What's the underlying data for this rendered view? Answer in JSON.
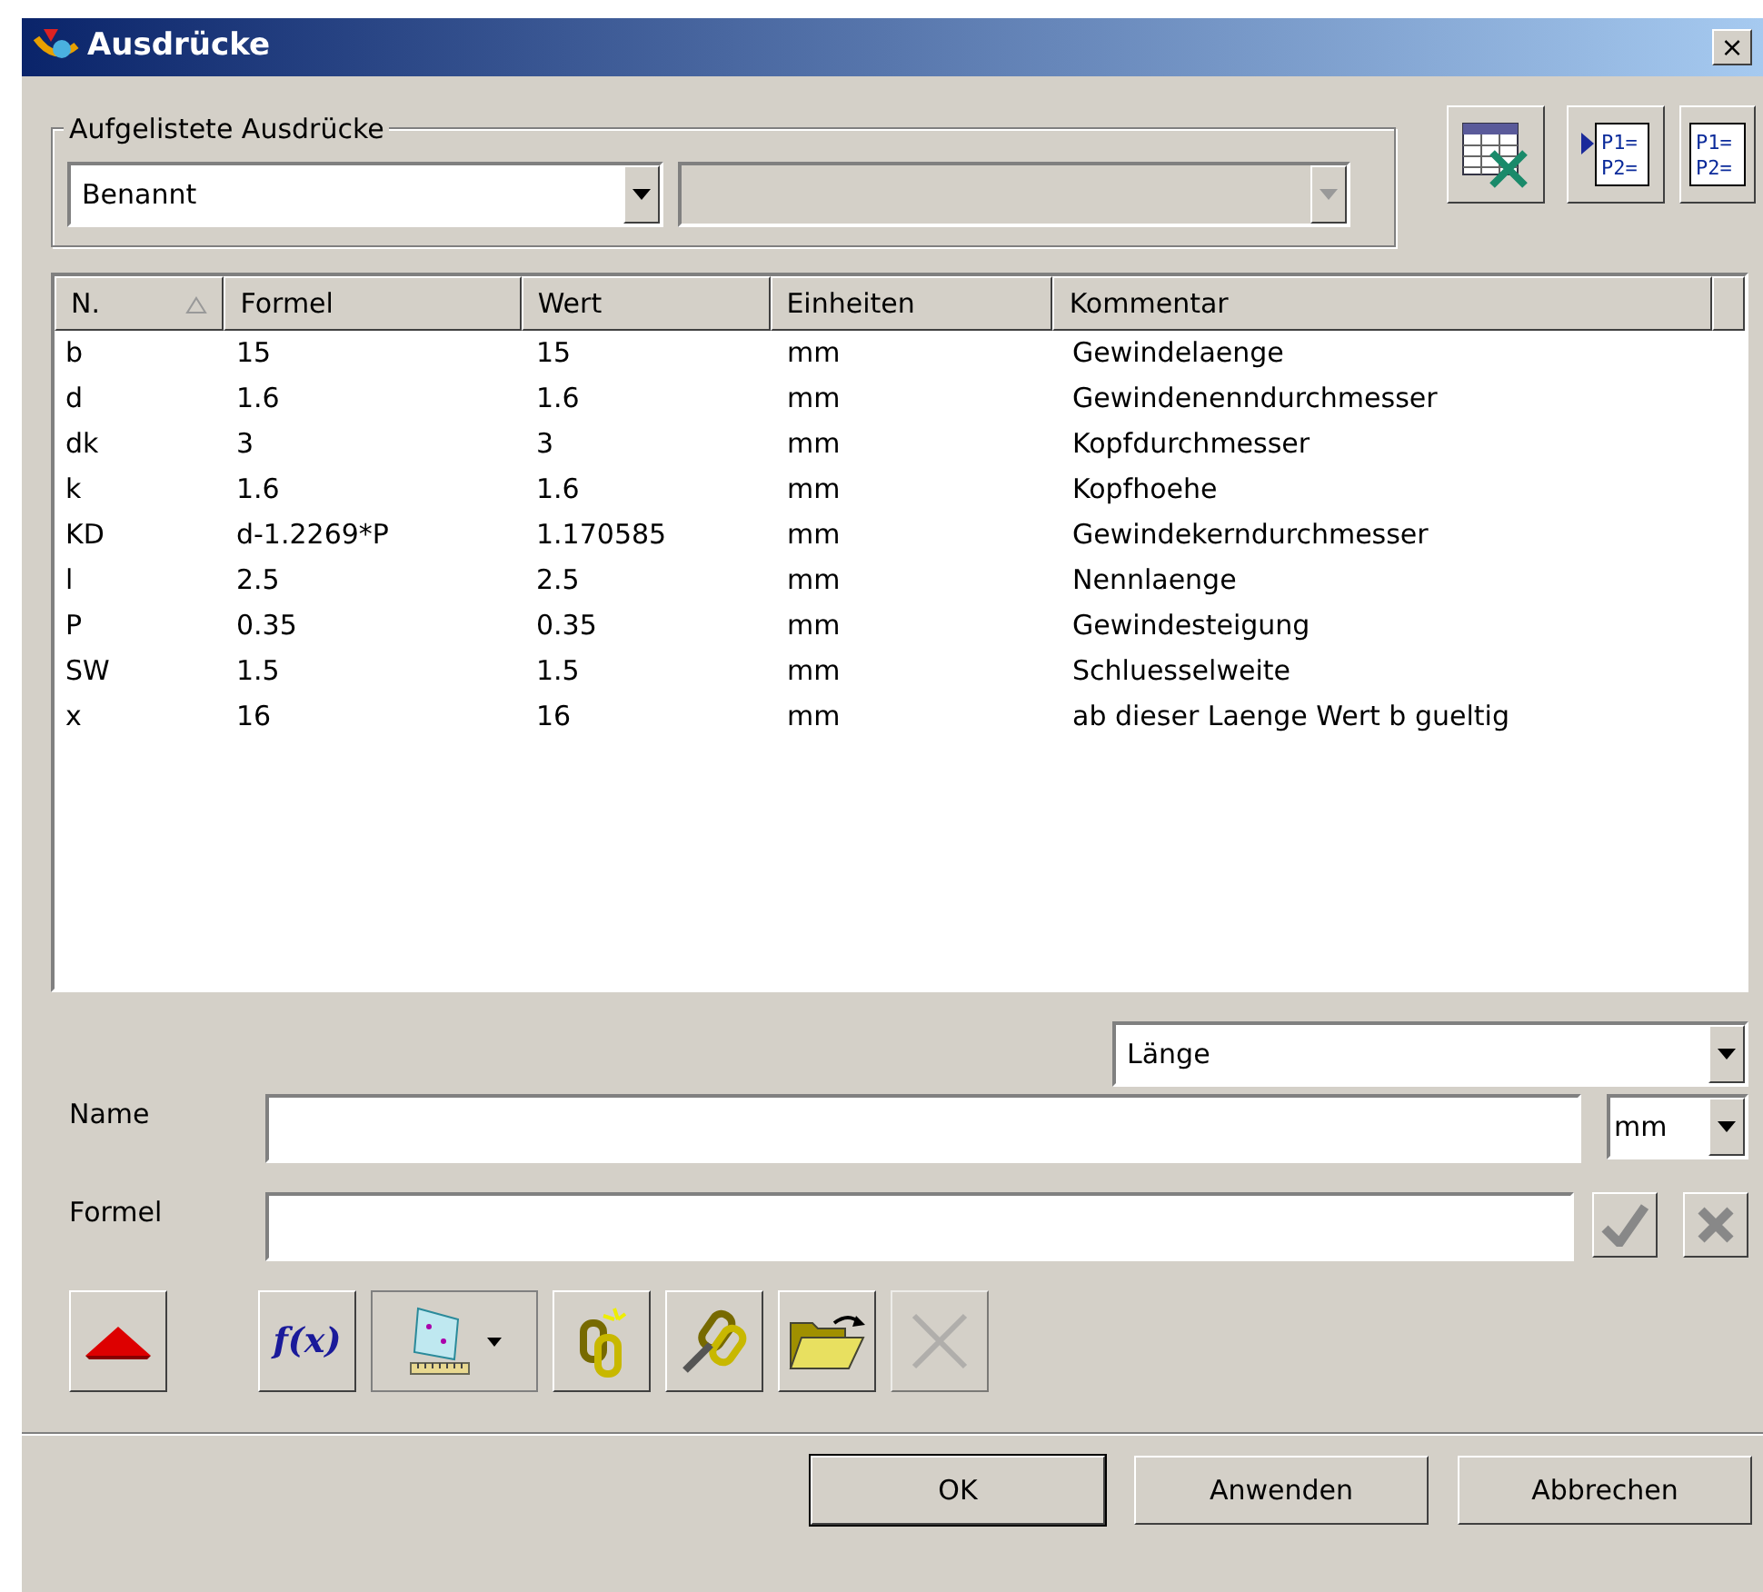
{
  "window": {
    "title": "Ausdrücke",
    "close": "×"
  },
  "listed_expressions": {
    "label": "Aufgelistete Ausdrücke",
    "filter": {
      "value": "Benannt",
      "disabled": false
    },
    "subfilter": {
      "disabled": true
    }
  },
  "top_tools": [
    {
      "kind": "spreadsheet",
      "disabled": false
    },
    {
      "kind": "params-arrow",
      "lines": [
        "P1=",
        "P2="
      ],
      "disabled": false
    },
    {
      "kind": "params",
      "lines": [
        "P1=",
        "P2="
      ],
      "disabled": false
    }
  ],
  "table": {
    "columns": [
      {
        "label": "N.",
        "sorted": true
      },
      {
        "label": "Formel",
        "sorted": false
      },
      {
        "label": "Wert",
        "sorted": false
      },
      {
        "label": "Einheiten",
        "sorted": false
      },
      {
        "label": "Kommentar",
        "sorted": false
      }
    ],
    "rows": [
      [
        "b",
        "15",
        "15",
        "mm",
        "Gewindelaenge"
      ],
      [
        "d",
        "1.6",
        "1.6",
        "mm",
        "Gewindenenndurchmesser"
      ],
      [
        "dk",
        "3",
        "3",
        "mm",
        "Kopfdurchmesser"
      ],
      [
        "k",
        "1.6",
        "1.6",
        "mm",
        "Kopfhoehe"
      ],
      [
        "KD",
        "d-1.2269*P",
        "1.170585",
        "mm",
        "Gewindekerndurchmesser"
      ],
      [
        "l",
        "2.5",
        "2.5",
        "mm",
        "Nennlaenge"
      ],
      [
        "P",
        "0.35",
        "0.35",
        "mm",
        "Gewindesteigung"
      ],
      [
        "SW",
        "1.5",
        "1.5",
        "mm",
        "Schluesselweite"
      ],
      [
        "x",
        "16",
        "16",
        "mm",
        "ab dieser Laenge Wert b gueltig"
      ]
    ]
  },
  "type_dropdown": {
    "value": "Länge"
  },
  "name_field": {
    "label": "Name",
    "unit": "mm"
  },
  "formula_field": {
    "label": "Formel",
    "accept_disabled": true,
    "reject_disabled": true
  },
  "tools": [
    {
      "kind": "collapse",
      "disabled": false
    },
    {
      "kind": "function",
      "label": "f(x)",
      "disabled": false
    },
    {
      "kind": "measure",
      "disabled": false
    },
    {
      "kind": "link-new",
      "disabled": false
    },
    {
      "kind": "link-edit",
      "disabled": false
    },
    {
      "kind": "open",
      "disabled": false
    },
    {
      "kind": "delete",
      "disabled": true
    }
  ],
  "buttons": [
    {
      "label": "OK",
      "default": true
    },
    {
      "label": "Anwenden",
      "default": false
    },
    {
      "label": "Abbrechen",
      "default": false
    }
  ]
}
